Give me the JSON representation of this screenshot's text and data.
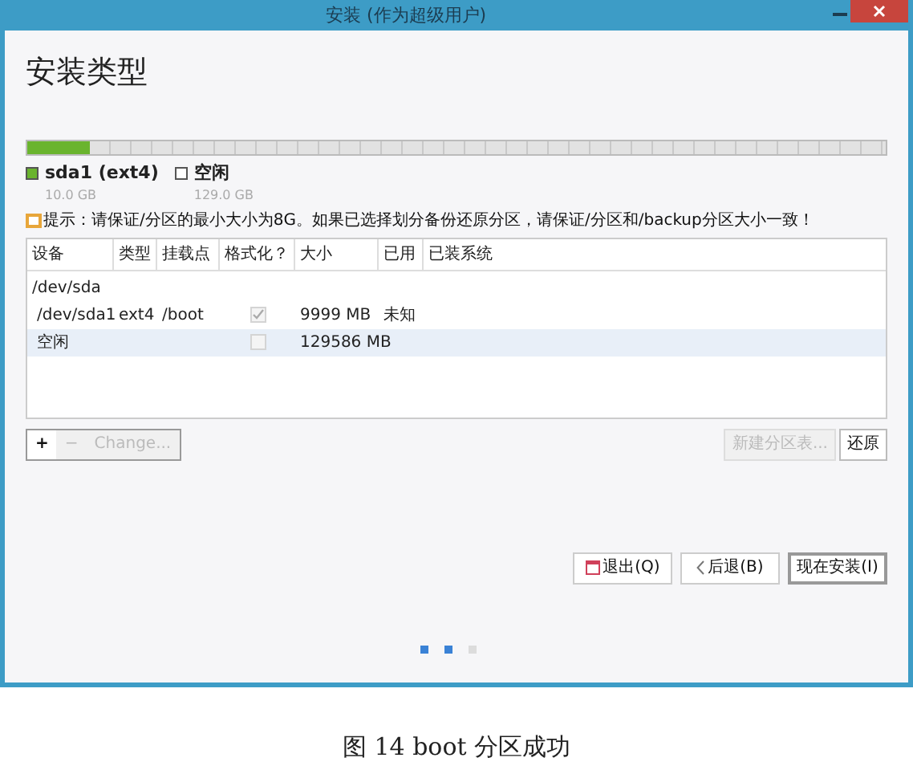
{
  "window": {
    "title": "安装 (作为超级用户)"
  },
  "heading": "安装类型",
  "disk_bar": {
    "segments": [
      {
        "label": "sda1 (ext4)",
        "size": "10.0 GB",
        "color": "#6ab42e",
        "level": 0.072
      },
      {
        "label": "空闲",
        "size": "129.0 GB",
        "color": "#ffffff"
      }
    ]
  },
  "hint": "提示：请保证/分区的最小大小为8G。如果已选择划分备份还原分区，请保证/分区和/backup分区大小一致！",
  "table": {
    "columns": [
      "设备",
      "类型",
      "挂载点",
      "格式化？",
      "大小",
      "已用",
      "已装系统"
    ],
    "rows": [
      {
        "kind": "disk",
        "device": "/dev/sda",
        "selected": false
      },
      {
        "kind": "partition",
        "device": "/dev/sda1",
        "type": "ext4",
        "mount": "/boot",
        "format": true,
        "size": "9999 MB",
        "used": "未知",
        "selected": false
      },
      {
        "kind": "partition",
        "device": "空闲",
        "format": false,
        "size": "129586 MB",
        "selected": true
      }
    ]
  },
  "table_buttons": [
    {
      "label": "+",
      "disabled": false
    },
    {
      "label": "−",
      "disabled": true
    },
    {
      "label": "Change...",
      "disabled": true
    }
  ],
  "partition_buttons": [
    {
      "label": "新建分区表...",
      "disabled": true
    },
    {
      "label": "还原",
      "disabled": false
    }
  ],
  "nav_buttons": [
    {
      "kind": "quit",
      "label": "退出(Q)"
    },
    {
      "kind": "back",
      "label": "后退(B)"
    },
    {
      "kind": "install",
      "label": "现在安装(I)"
    }
  ],
  "steps": [
    {
      "done": true
    },
    {
      "done": true
    },
    {
      "done": false
    }
  ],
  "caption": "图  14 boot 分区成功"
}
